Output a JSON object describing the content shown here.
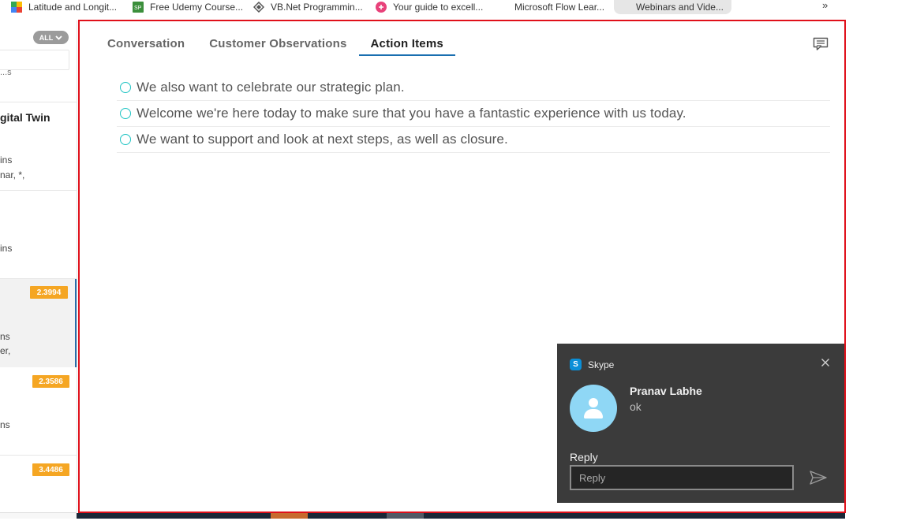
{
  "bookmarks": [
    {
      "label": "Latitude and Longit...",
      "icon": "maps-icon"
    },
    {
      "label": "Free Udemy Course...",
      "icon": "sp-icon"
    },
    {
      "label": "VB.Net Programmin...",
      "icon": "vbnet-icon"
    },
    {
      "label": "Your guide to excell...",
      "icon": "pink-plus-icon"
    },
    {
      "label": "Microsoft Flow Lear...",
      "icon": "microsoft-logo-icon"
    },
    {
      "label": "Webinars and Vide...",
      "icon": "microsoft-logo-icon"
    }
  ],
  "bookmarks_more": "»",
  "left_panel": {
    "filter_label": "ALL",
    "fragments": {
      "f1": "...s",
      "f2": "gital Twin",
      "f3": "ins",
      "f4": "nar, *,",
      "f5": "ins",
      "f6": "ns",
      "f7": "er,",
      "f8": "ns"
    },
    "scores": [
      "2.3994",
      "2.3586",
      "3.4486"
    ]
  },
  "main": {
    "tabs": [
      {
        "label": "Conversation",
        "active": false
      },
      {
        "label": "Customer Observations",
        "active": false
      },
      {
        "label": "Action Items",
        "active": true
      }
    ],
    "action_items": [
      "We also want to celebrate our strategic plan.",
      "Welcome we're here today to make sure that you have a fantastic experience with us today.",
      "We want to support and look at next steps, as well as closure."
    ]
  },
  "toast": {
    "app_name": "Skype",
    "sender_name": "Pranav Labhe",
    "message": "ok",
    "reply_label": "Reply",
    "reply_placeholder": "Reply"
  },
  "colors": {
    "panel_border": "#e0101a",
    "active_tab_underline": "#1a6fb0",
    "radio_ring": "#20c4c4",
    "score_badge": "#f5a623",
    "toast_bg": "#3b3b3b",
    "avatar_bg": "#8fd7f5"
  }
}
